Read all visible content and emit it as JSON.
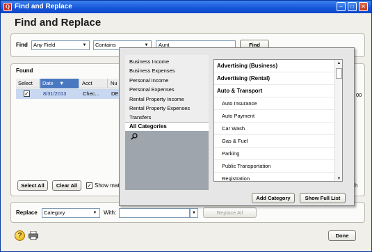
{
  "window": {
    "title": "Find and Replace",
    "app_icon": "Q"
  },
  "heading": "Find and Replace",
  "find": {
    "label": "Find",
    "field_value": "Any Field",
    "condition_value": "Contains",
    "search_value": "Aunt",
    "button": "Find"
  },
  "found": {
    "label": "Found",
    "columns": [
      "Select",
      "Date",
      "Acct",
      "Nu"
    ],
    "row": {
      "date": "8/31/2013",
      "acct": "Chec...",
      "num": "DE"
    },
    "select_all": "Select All",
    "clear_all": "Clear All",
    "show_matches": "Show mat",
    "right_partial_text": "00",
    "right_partial_text2": "h"
  },
  "replace": {
    "label": "Replace",
    "field_value": "Category",
    "with_label": "With:",
    "with_value": "",
    "button": "Replace All"
  },
  "popup": {
    "groups": [
      "Business Income",
      "Business Expenses",
      "Personal Income",
      "Personal Expenses",
      "Rental Property Income",
      "Rental Property Expenses",
      "Transfers"
    ],
    "all_categories": "All Categories",
    "categories": [
      {
        "label": "Advertising (Business)",
        "kind": "head"
      },
      {
        "label": "Advertising (Rental)",
        "kind": "head"
      },
      {
        "label": "Auto & Transport",
        "kind": "head"
      },
      {
        "label": "Auto Insurance",
        "kind": "sub"
      },
      {
        "label": "Auto Payment",
        "kind": "sub"
      },
      {
        "label": "Car Wash",
        "kind": "sub"
      },
      {
        "label": "Gas & Fuel",
        "kind": "sub"
      },
      {
        "label": "Parking",
        "kind": "sub"
      },
      {
        "label": "Public Transportation",
        "kind": "sub"
      },
      {
        "label": "Registration",
        "kind": "sub"
      }
    ],
    "add_category": "Add Category",
    "show_full_list": "Show Full List"
  },
  "done": "Done",
  "icons": {
    "help": "help-icon",
    "print": "printer-icon",
    "search": "magnifier-icon"
  }
}
